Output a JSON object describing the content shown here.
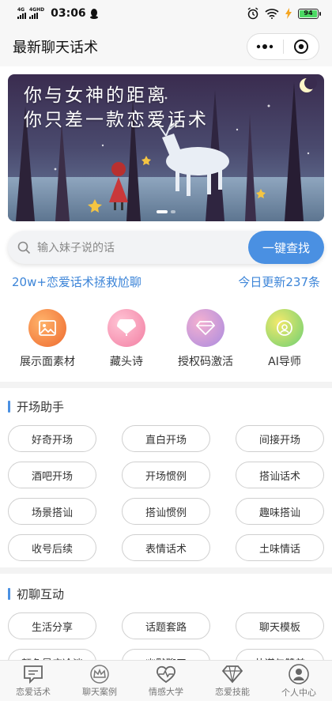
{
  "status_bar": {
    "signal1": "4G",
    "signal2": "4GHD",
    "time": "03:06",
    "battery": "94"
  },
  "nav": {
    "title": "最新聊天话术"
  },
  "banner": {
    "line1": "你与女神的距离",
    "line2": "你只差一款恋爱话术",
    "page_count": 2,
    "active_page": 1
  },
  "search": {
    "placeholder": "输入妹子说的话",
    "button": "一键查找"
  },
  "stats": {
    "left": "20w+恋爱话术拯救尬聊",
    "right": "今日更新237条"
  },
  "features": [
    {
      "label": "展示面素材",
      "icon": "image-icon",
      "color": "#f27b3d"
    },
    {
      "label": "藏头诗",
      "icon": "fan-icon",
      "color": "#f59ab5"
    },
    {
      "label": "授权码激活",
      "icon": "diamond-icon",
      "color": "#c89ae0"
    },
    {
      "label": "AI导师",
      "icon": "robot-icon",
      "color": "#8fd66a"
    }
  ],
  "sections": [
    {
      "title": "开场助手",
      "tags": [
        "好奇开场",
        "直白开场",
        "间接开场",
        "酒吧开场",
        "开场惯例",
        "搭讪话术",
        "场景搭讪",
        "搭讪惯例",
        "趣味搭讪",
        "收号后续",
        "表情话术",
        "土味情话"
      ]
    },
    {
      "title": "初聊互动",
      "tags": [
        "生活分享",
        "话题套路",
        "聊天模板",
        "颜色是应冷淡",
        "幽默聊天",
        "共谋与赞美"
      ]
    }
  ],
  "tabbar": [
    {
      "label": "恋爱话术",
      "icon": "chat-icon"
    },
    {
      "label": "聊天案例",
      "icon": "crown-icon"
    },
    {
      "label": "情感大学",
      "icon": "heart-icon"
    },
    {
      "label": "恋爱技能",
      "icon": "gem-icon"
    },
    {
      "label": "个人中心",
      "icon": "user-icon"
    }
  ]
}
